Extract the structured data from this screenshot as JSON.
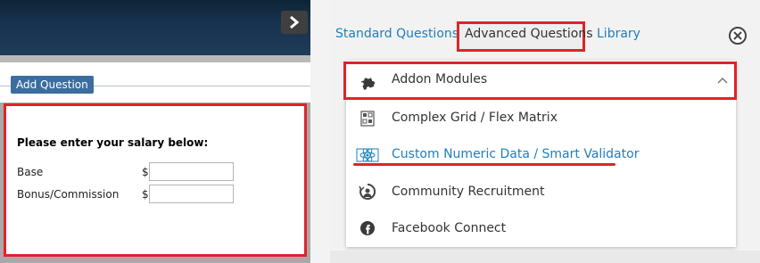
{
  "editor": {
    "add_question_label": "Add Question",
    "question": {
      "title": "Please enter your salary below:",
      "rows": [
        {
          "label": "Base",
          "currency": "$",
          "value": ""
        },
        {
          "label": "Bonus/Commission",
          "currency": "$",
          "value": ""
        }
      ]
    }
  },
  "panel": {
    "tabs": [
      {
        "label": "Standard Questions",
        "active": false
      },
      {
        "label": "Advanced Questions",
        "active": true
      },
      {
        "label": "Library",
        "active": false
      }
    ],
    "dropdown": {
      "header": {
        "label": "Addon Modules",
        "icon": "puzzle-icon"
      },
      "items": [
        {
          "label": "Complex Grid / Flex Matrix",
          "icon": "grid-icon"
        },
        {
          "label": "Custom Numeric Data / Smart Validator",
          "icon": "atom-icon",
          "highlighted": true
        },
        {
          "label": "Community Recruitment",
          "icon": "community-icon"
        },
        {
          "label": "Facebook Connect",
          "icon": "facebook-icon"
        }
      ]
    }
  },
  "colors": {
    "accent_blue": "#1d7fbc",
    "highlight_red": "#e1222b",
    "header_navy": "#17324f",
    "button_blue": "#3c6d9f"
  }
}
